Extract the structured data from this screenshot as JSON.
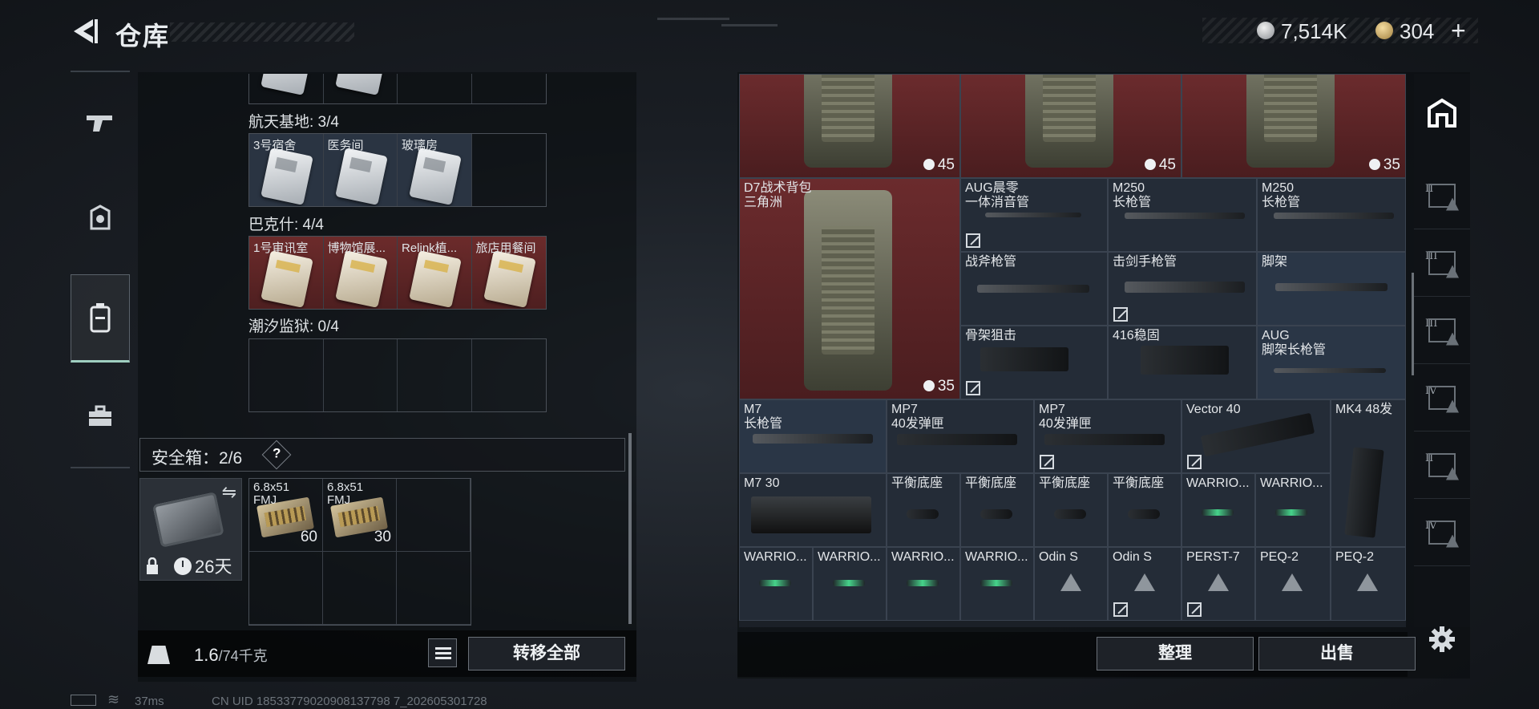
{
  "header": {
    "title": "仓库",
    "currency_silver": "7,514K",
    "currency_gold": "304",
    "add_symbol": "+"
  },
  "left": {
    "sections": [
      {
        "label": "航天基地: 3/4",
        "cells": [
          "3号宿舍",
          "医务间",
          "玻璃房",
          ""
        ]
      },
      {
        "label": "巴克什: 4/4",
        "cells": [
          "1号审讯室",
          "博物馆展...",
          "Relink植...",
          "旅店用餐间"
        ]
      },
      {
        "label": "潮汐监狱: 0/4",
        "cells": [
          "",
          "",
          "",
          ""
        ]
      }
    ],
    "safebox": {
      "label": "安全箱：2/6",
      "help": "?",
      "days": "26天"
    },
    "safe_items": [
      {
        "name": "6.8x51\nFMJ",
        "count": "60"
      },
      {
        "name": "6.8x51\nFMJ",
        "count": "30"
      }
    ],
    "weight": "1.6",
    "weight_max": "/74千克",
    "move_all": "转移全部"
  },
  "stash": {
    "top_caps": [
      "45",
      "45",
      "35"
    ],
    "backpack": {
      "name": "D7战术背包\n三角洲",
      "cap": "35"
    },
    "items": [
      {
        "key": "aug_sup",
        "name": "AUG晨零\n一体消音管"
      },
      {
        "key": "m250a",
        "name": "M250\n长枪管"
      },
      {
        "key": "m250b",
        "name": "M250\n长枪管"
      },
      {
        "key": "zhanfu",
        "name": "战斧枪管"
      },
      {
        "key": "jijian",
        "name": "击剑手枪管"
      },
      {
        "key": "jiaojia",
        "name": "脚架"
      },
      {
        "key": "gujia",
        "name": "骨架狙击"
      },
      {
        "key": "w416",
        "name": "416稳固"
      },
      {
        "key": "aug_bp",
        "name": "AUG\n脚架长枪管"
      },
      {
        "key": "m7",
        "name": "M7\n长枪管"
      },
      {
        "key": "mp7a",
        "name": "MP7\n40发弹匣"
      },
      {
        "key": "mp7b",
        "name": "MP7\n40发弹匣"
      },
      {
        "key": "vector",
        "name": "Vector 40"
      },
      {
        "key": "mk4",
        "name": "MK4 48发"
      },
      {
        "key": "m730",
        "name": "M7 30"
      },
      {
        "key": "ph1",
        "name": "平衡底座"
      },
      {
        "key": "ph2",
        "name": "平衡底座"
      },
      {
        "key": "ph3",
        "name": "平衡底座"
      },
      {
        "key": "ph4",
        "name": "平衡底座"
      },
      {
        "key": "war1",
        "name": "WARRIO..."
      },
      {
        "key": "war2",
        "name": "WARRIO..."
      },
      {
        "key": "war3",
        "name": "WARRIO..."
      },
      {
        "key": "war4",
        "name": "WARRIO..."
      },
      {
        "key": "war5",
        "name": "WARRIO..."
      },
      {
        "key": "war6",
        "name": "WARRIO..."
      },
      {
        "key": "odin1",
        "name": "Odin S"
      },
      {
        "key": "odin2",
        "name": "Odin S"
      },
      {
        "key": "perst",
        "name": "PERST-7"
      },
      {
        "key": "peq1",
        "name": "PEQ-2"
      },
      {
        "key": "peq2",
        "name": "PEQ-2"
      }
    ],
    "sort": "整理",
    "sell": "出售"
  },
  "rightnav_tiers": [
    "II",
    "III",
    "III",
    "IV",
    "II",
    "IV"
  ],
  "status": {
    "ping": "37ms",
    "uid": "CN UID 18533779020908137798 7_202605301728"
  },
  "colors": {
    "red_slot": "#6b2b2d",
    "blue_slot": "#2a3646",
    "accent": "#9fcfc0"
  }
}
